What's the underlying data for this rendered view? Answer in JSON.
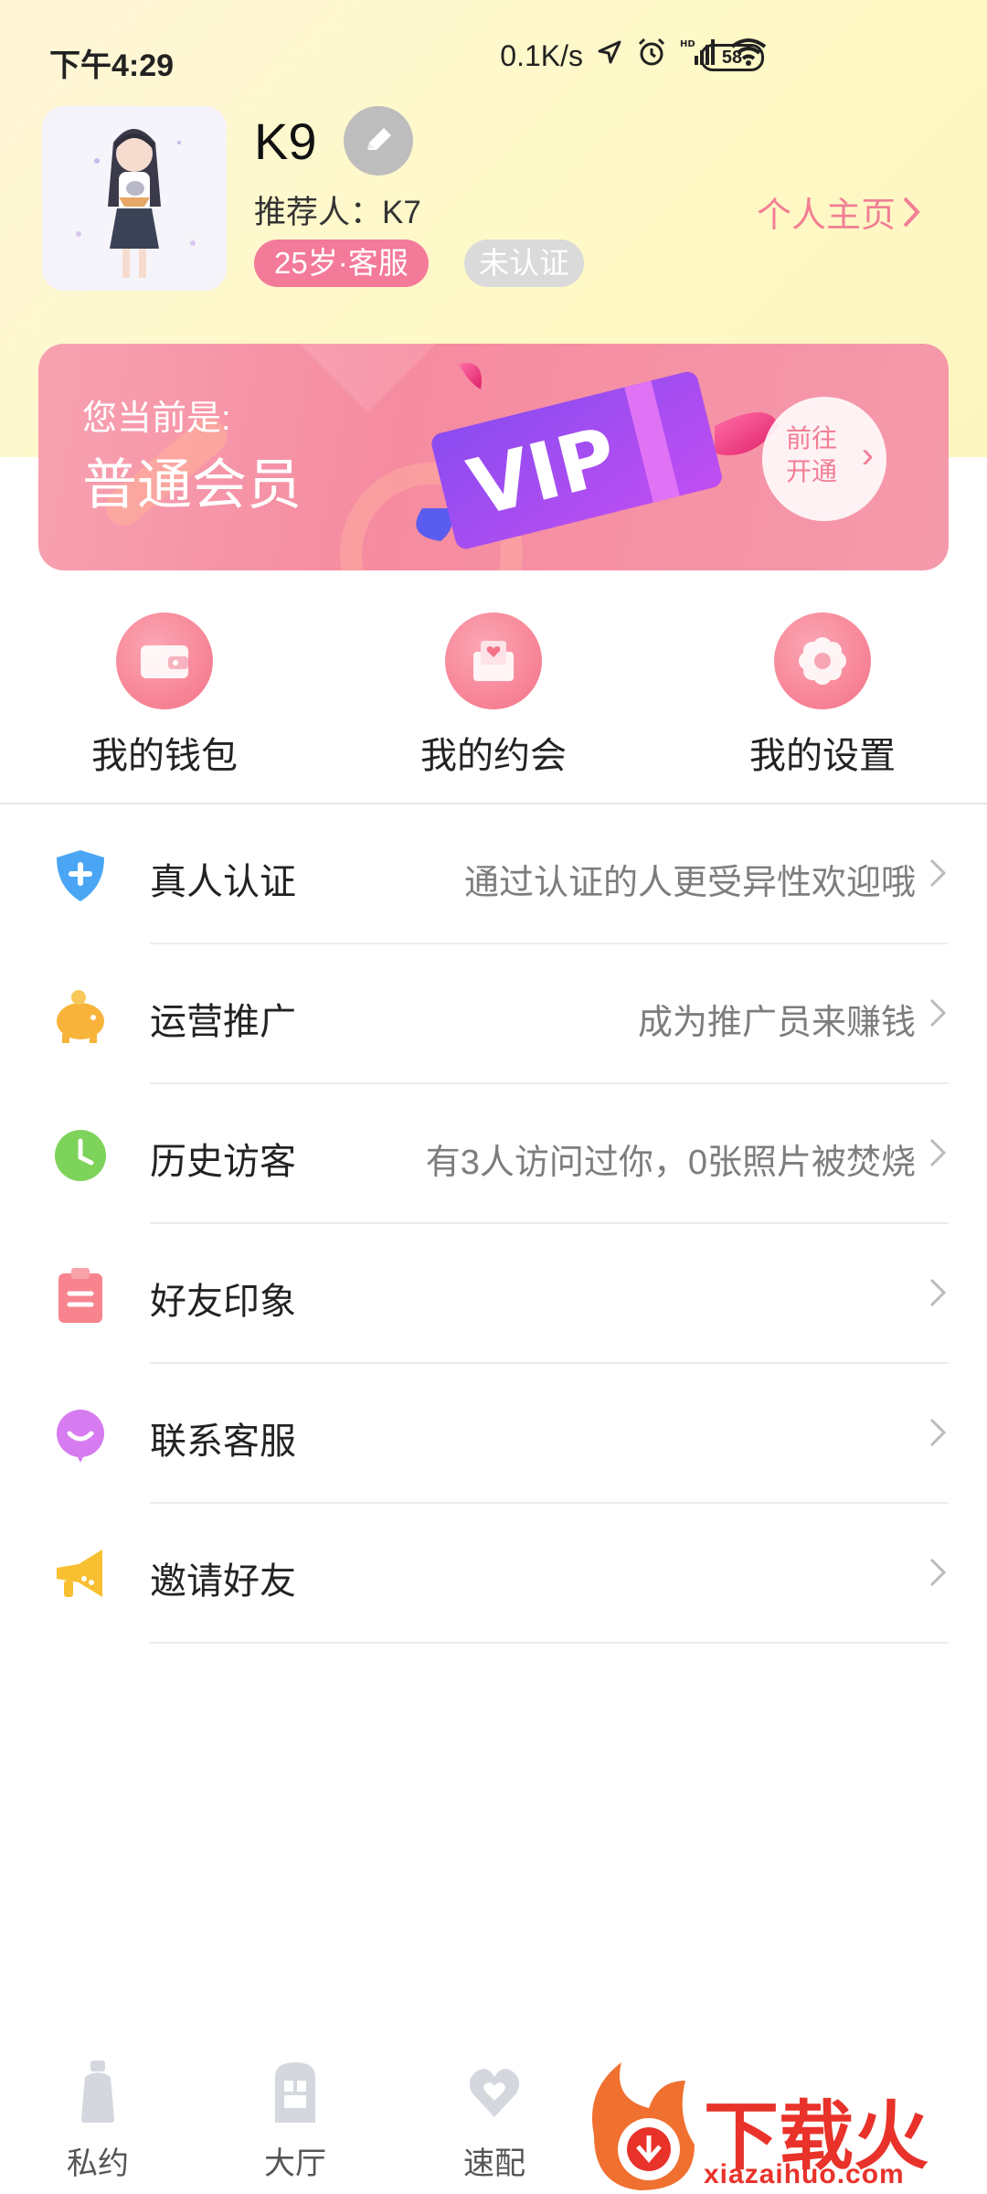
{
  "status_bar": {
    "time": "下午4:29",
    "network_speed": "0.1K/s",
    "battery": "58"
  },
  "profile": {
    "name": "K9",
    "referrer": "推荐人：K7",
    "age_tag": "25岁·客服",
    "auth_tag": "未认证",
    "homepage_link": "个人主页"
  },
  "vip": {
    "line1": "您当前是:",
    "line2": "普通会员",
    "badge": "VIP",
    "open_line1": "前往",
    "open_line2": "开通"
  },
  "quick_actions": [
    {
      "label": "我的钱包",
      "icon": "wallet-icon"
    },
    {
      "label": "我的约会",
      "icon": "date-envelope-icon"
    },
    {
      "label": "我的设置",
      "icon": "settings-flower-icon"
    }
  ],
  "menu": [
    {
      "label": "真人认证",
      "desc": "通过认证的人更受异性欢迎哦",
      "icon": "shield-plus-icon",
      "color": "#4aa6f5"
    },
    {
      "label": "运营推广",
      "desc": "成为推广员来赚钱",
      "icon": "piggy-bank-icon",
      "color": "#f8b43a"
    },
    {
      "label": "历史访客",
      "desc": "有3人访问过你，0张照片被焚烧",
      "icon": "clock-icon",
      "color": "#7ed35a"
    },
    {
      "label": "好友印象",
      "desc": "",
      "icon": "clipboard-icon",
      "color": "#f7848f"
    },
    {
      "label": "联系客服",
      "desc": "",
      "icon": "chat-bubble-icon",
      "color": "#d67cf0"
    },
    {
      "label": "邀请好友",
      "desc": "",
      "icon": "megaphone-icon",
      "color": "#f8c030"
    }
  ],
  "bottom_nav": [
    {
      "label": "私约",
      "icon": "bottle-icon"
    },
    {
      "label": "大厅",
      "icon": "hall-icon"
    },
    {
      "label": "速配",
      "icon": "heart-icon"
    }
  ],
  "watermark": {
    "text": "下载火",
    "url": "xiazaihuo.com"
  }
}
